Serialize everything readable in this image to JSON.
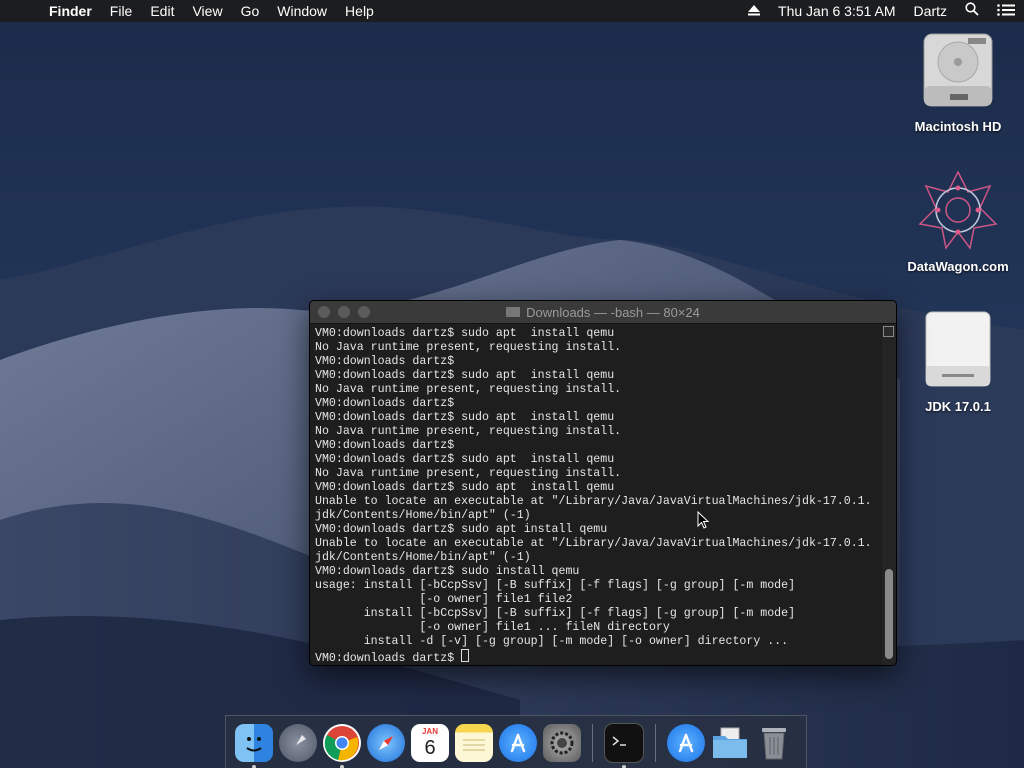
{
  "menubar": {
    "apple_glyph": "",
    "app_name": "Finder",
    "items": [
      "File",
      "Edit",
      "View",
      "Go",
      "Window",
      "Help"
    ],
    "datetime": "Thu Jan 6  3:51 AM",
    "user": "Dartz"
  },
  "desktop_icons": [
    {
      "label": "Macintosh HD",
      "icon": "hard-drive-icon"
    },
    {
      "label": "DataWagon.com",
      "icon": "datawagon-icon"
    },
    {
      "label": "JDK 17.0.1",
      "icon": "disk-image-icon"
    }
  ],
  "terminal": {
    "title": "Downloads — -bash — 80×24",
    "lines": [
      "VM0:downloads dartz$ sudo apt  install qemu",
      "No Java runtime present, requesting install.",
      "VM0:downloads dartz$",
      "VM0:downloads dartz$ sudo apt  install qemu",
      "No Java runtime present, requesting install.",
      "VM0:downloads dartz$",
      "VM0:downloads dartz$ sudo apt  install qemu",
      "No Java runtime present, requesting install.",
      "VM0:downloads dartz$",
      "VM0:downloads dartz$ sudo apt  install qemu",
      "No Java runtime present, requesting install.",
      "VM0:downloads dartz$ sudo apt  install qemu",
      "Unable to locate an executable at \"/Library/Java/JavaVirtualMachines/jdk-17.0.1.",
      "jdk/Contents/Home/bin/apt\" (-1)",
      "VM0:downloads dartz$ sudo apt install qemu",
      "Unable to locate an executable at \"/Library/Java/JavaVirtualMachines/jdk-17.0.1.",
      "jdk/Contents/Home/bin/apt\" (-1)",
      "VM0:downloads dartz$ sudo install qemu",
      "usage: install [-bCcpSsv] [-B suffix] [-f flags] [-g group] [-m mode]",
      "               [-o owner] file1 file2",
      "       install [-bCcpSsv] [-B suffix] [-f flags] [-g group] [-m mode]",
      "               [-o owner] file1 ... fileN directory",
      "       install -d [-v] [-g group] [-m mode] [-o owner] directory ..."
    ],
    "prompt": "VM0:downloads dartz$ "
  },
  "dock": {
    "items": [
      {
        "name": "finder",
        "running": true,
        "color": "#3a8ee6"
      },
      {
        "name": "launchpad",
        "running": false,
        "color": "#6d7583"
      },
      {
        "name": "chrome",
        "running": true,
        "color": "#ffffff"
      },
      {
        "name": "safari",
        "running": false,
        "color": "#2f8bf0"
      },
      {
        "name": "calendar",
        "running": false,
        "color": "#ffffff",
        "month": "JAN",
        "day": "6"
      },
      {
        "name": "notes",
        "running": false,
        "color": "#f7e27a"
      },
      {
        "name": "app-store",
        "running": false,
        "color": "#1f8bf5"
      },
      {
        "name": "system-preferences",
        "running": false,
        "color": "#7b7b7b"
      },
      {
        "name": "terminal",
        "running": true,
        "color": "#111111"
      },
      {
        "name": "app-store-downloads",
        "running": false,
        "color": "#1f8bf5"
      },
      {
        "name": "downloads-folder",
        "running": false,
        "color": "#5ba3e0"
      },
      {
        "name": "trash",
        "running": false,
        "color": "#8a8f96"
      }
    ]
  }
}
